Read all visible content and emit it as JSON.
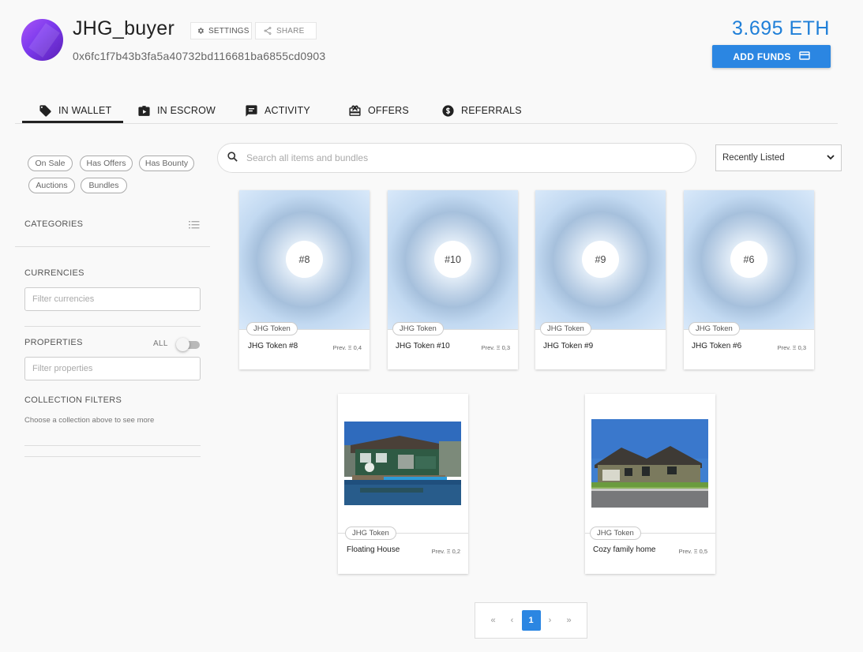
{
  "profile": {
    "username": "JHG_buyer",
    "address": "0x6fc1f7b43b3fa5a40732bd116681ba6855cd0903",
    "settings_label": "SETTINGS",
    "share_label": "SHARE"
  },
  "wallet": {
    "balance": "3.695 ETH",
    "add_funds_label": "ADD FUNDS"
  },
  "tabs": [
    {
      "label": "IN WALLET",
      "icon": "tag-icon",
      "active": true
    },
    {
      "label": "IN ESCROW",
      "icon": "escrow-icon",
      "active": false
    },
    {
      "label": "ACTIVITY",
      "icon": "activity-icon",
      "active": false
    },
    {
      "label": "OFFERS",
      "icon": "offers-icon",
      "active": false
    },
    {
      "label": "REFERRALS",
      "icon": "dollar-icon",
      "active": false
    }
  ],
  "sidebar": {
    "chips": [
      "On Sale",
      "Has Offers",
      "Has Bounty",
      "Auctions",
      "Bundles"
    ],
    "categories_label": "CATEGORIES",
    "currencies_label": "CURRENCIES",
    "currencies_placeholder": "Filter currencies",
    "properties_label": "PROPERTIES",
    "properties_all_label": "ALL",
    "properties_placeholder": "Filter properties",
    "collection_filters_label": "COLLECTION FILTERS",
    "collection_filters_hint": "Choose a collection above to see more"
  },
  "search": {
    "placeholder": "Search all items and bundles",
    "sort_value": "Recently Listed"
  },
  "cards": [
    {
      "badge": "#8",
      "collection": "JHG Token",
      "name": "JHG Token #8",
      "prev": "Prev. Ξ 0,4"
    },
    {
      "badge": "#10",
      "collection": "JHG Token",
      "name": "JHG Token #10",
      "prev": "Prev. Ξ 0,3"
    },
    {
      "badge": "#9",
      "collection": "JHG Token",
      "name": "JHG Token #9",
      "prev": ""
    },
    {
      "badge": "#6",
      "collection": "JHG Token",
      "name": "JHG Token #6",
      "prev": "Prev. Ξ 0,3"
    },
    {
      "badge": "",
      "collection": "JHG Token",
      "name": "Floating House",
      "prev": "Prev. Ξ 0,2"
    },
    {
      "badge": "",
      "collection": "JHG Token",
      "name": "Cozy family home",
      "prev": "Prev. Ξ 0,5"
    }
  ],
  "pagination": {
    "first": "«",
    "prev": "‹",
    "current": "1",
    "next": "›",
    "last": "»"
  },
  "colors": {
    "accent": "#2b86e2",
    "balance": "#1f7fd8",
    "avatar": "#7c3aed"
  }
}
